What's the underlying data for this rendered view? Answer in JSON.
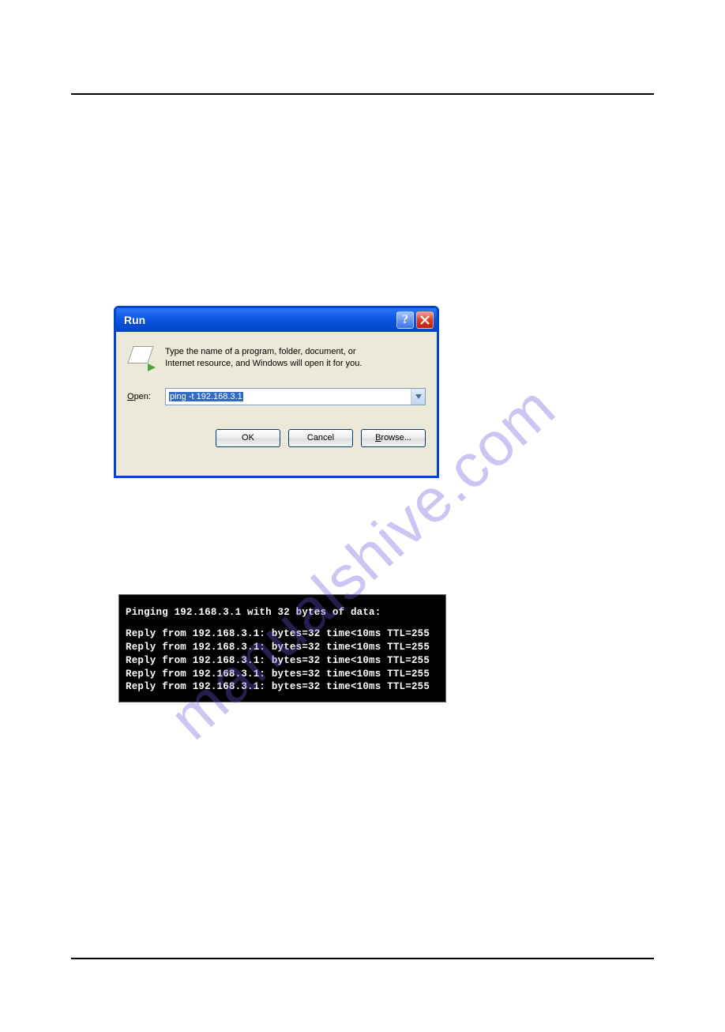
{
  "dialog": {
    "title": "Run",
    "description_line1": "Type the name of a program, folder, document, or",
    "description_line2": "Internet resource, and Windows will open it for you.",
    "open_label_prefix": "O",
    "open_label_rest": "pen:",
    "input_value": "ping -t 192.168.3.1",
    "buttons": {
      "ok": "OK",
      "cancel": "Cancel",
      "browse_prefix": "B",
      "browse_rest": "rowse..."
    }
  },
  "console": {
    "header": "Pinging 192.168.3.1 with 32 bytes of data:",
    "lines": [
      "Reply from 192.168.3.1: bytes=32 time<10ms TTL=255",
      "Reply from 192.168.3.1: bytes=32 time<10ms TTL=255",
      "Reply from 192.168.3.1: bytes=32 time<10ms TTL=255",
      "Reply from 192.168.3.1: bytes=32 time<10ms TTL=255",
      "Reply from 192.168.3.1: bytes=32 time<10ms TTL=255"
    ]
  },
  "watermark": "manualshive.com"
}
